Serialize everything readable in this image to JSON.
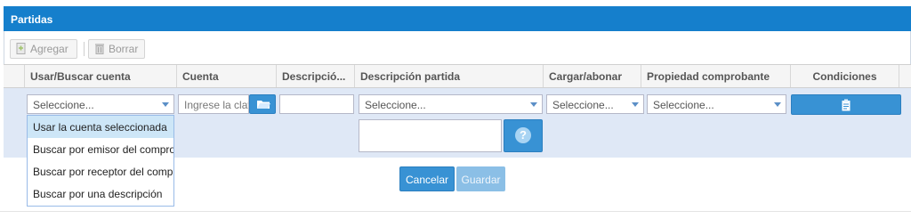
{
  "panel": {
    "title": "Partidas"
  },
  "toolbar": {
    "add_label": "Agregar",
    "delete_label": "Borrar"
  },
  "columns": [
    "Usar/Buscar cuenta",
    "Cuenta",
    "Descripció...",
    "Descripción partida",
    "Cargar/abonar",
    "Propiedad comprobante",
    "Condiciones"
  ],
  "editor": {
    "usar_buscar_value": "Seleccione...",
    "cuenta_placeholder": "Ingrese la clav",
    "descripcion_value": "",
    "descripcion_partida_value": "Seleccione...",
    "cargar_abonar_value": "Seleccione...",
    "propiedad_value": "Seleccione...",
    "help_label": "?",
    "cancel_label": "Cancelar",
    "save_label": "Guardar"
  },
  "dropdown": {
    "items": [
      "Usar la cuenta seleccionada",
      "Buscar por emisor del comprobante",
      "Buscar por receptor del comprobante",
      "Buscar por una descripción"
    ]
  },
  "colors": {
    "accent": "#157fcc",
    "button": "#3892d4",
    "row_edit": "#dfe8f6"
  }
}
